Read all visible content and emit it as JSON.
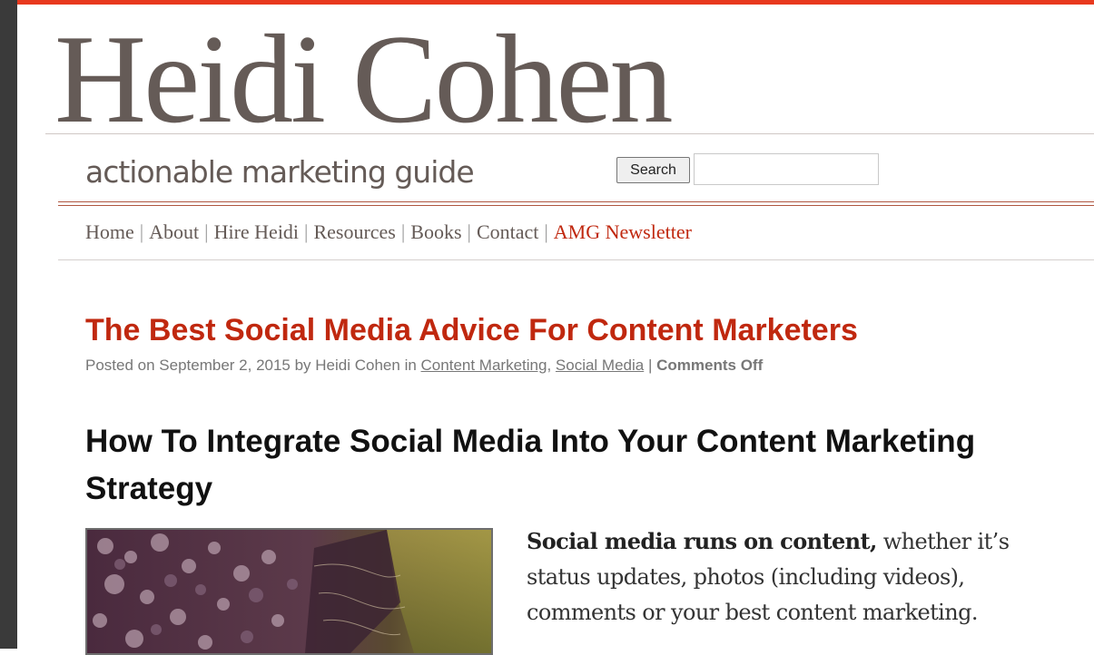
{
  "site": {
    "logo_text": "Heidi Cohen",
    "tagline": "actionable marketing guide"
  },
  "search": {
    "button_label": "Search",
    "input_value": "",
    "placeholder": ""
  },
  "nav": {
    "items": [
      {
        "label": "Home"
      },
      {
        "label": "About"
      },
      {
        "label": "Hire Heidi"
      },
      {
        "label": "Resources"
      },
      {
        "label": "Books"
      },
      {
        "label": "Contact"
      },
      {
        "label": "AMG Newsletter"
      }
    ],
    "separator": "|"
  },
  "post": {
    "title": "The Best Social Media Advice For Content Marketers",
    "meta": {
      "posted_on": "Posted on September 2, 2015 by Heidi Cohen in",
      "category1": "Content Marketing",
      "comma": ",",
      "category2": "Social Media",
      "pipe": "|",
      "comments": "Comments Off"
    },
    "subheading": "How To Integrate Social Media Into Your Content Marketing Strategy",
    "image_alt": "puzzle-image",
    "body_bold": "Social media runs on content,",
    "body_rest": " whether it’s status updates, photos (including videos), comments or your best content marketing."
  },
  "colors": {
    "accent_red": "#c0280f",
    "top_bar": "#e8391e",
    "logo_gray": "#655b57",
    "left_bar": "#3a3a3a"
  }
}
